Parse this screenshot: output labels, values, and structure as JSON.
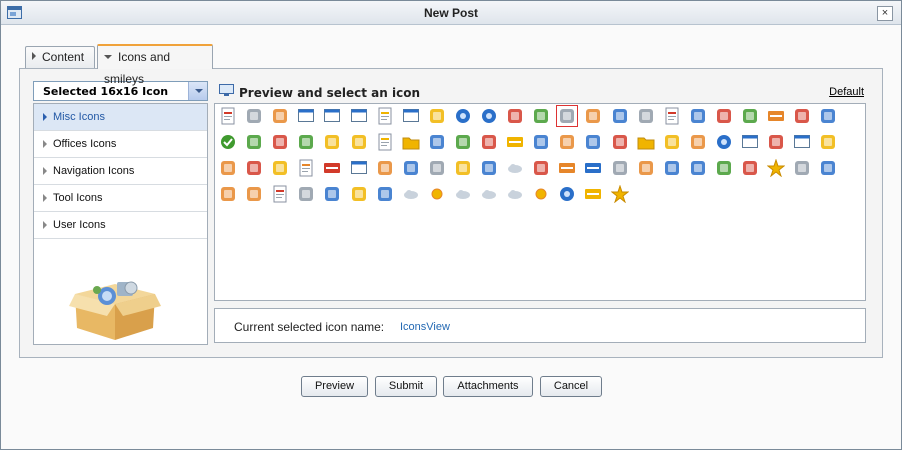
{
  "window": {
    "title": "New Post",
    "close_glyph": "×"
  },
  "tabs": [
    {
      "label": "Content",
      "active": false
    },
    {
      "label": "Icons and smileys",
      "active": true
    }
  ],
  "icon_select": {
    "value": "Selected 16x16 Icon"
  },
  "categories": [
    {
      "label": "Misc Icons",
      "active": true
    },
    {
      "label": "Offices Icons",
      "active": false
    },
    {
      "label": "Navigation Icons",
      "active": false
    },
    {
      "label": "Tool Icons",
      "active": false
    },
    {
      "label": "User Icons",
      "active": false
    }
  ],
  "preview": {
    "title": "Preview and select an icon",
    "default_link": "Default"
  },
  "current": {
    "label": "Current selected icon name:",
    "value": "IconsView"
  },
  "icons": {
    "rows": [
      [
        "pdf-icon",
        "user-icon",
        "copy-icon",
        "window-icon",
        "form-icon",
        "dialog-icon",
        "text-icon",
        "layout-icon",
        "terminal-icon",
        "globe-icon",
        "info-icon",
        "bomb-icon",
        "bookmark-icon",
        "link-icon",
        "cube-icon",
        "list-icon",
        "forward-icon",
        "edit-icon",
        "comment-icon",
        "settings-icon",
        "server-icon",
        "css-icon",
        "print-icon",
        "download-icon"
      ],
      [
        "check-icon",
        "pencil-icon",
        "puzzle-icon",
        "flag-icon",
        "clock-icon",
        "book-icon",
        "pdf-icon",
        "folder-icon",
        "font-icon",
        "hand-icon",
        "home-icon",
        "html-icon",
        "hammer-icon",
        "grid-icon",
        "move-icon",
        "cards-icon",
        "folder-icon",
        "move-icon",
        "stack-icon",
        "info-icon",
        "window-icon",
        "drive-icon",
        "window-icon",
        "link-icon"
      ],
      [
        "lock-icon",
        "record-icon",
        "magnet-icon",
        "notepad-icon",
        "new-icon",
        "frame-icon",
        "copy-icon",
        "zoom-icon",
        "printer-icon",
        "image-icon",
        "refresh-icon",
        "rainbow-icon",
        "recycle-icon",
        "rss-icon",
        "rss-icon",
        "people-icon",
        "shield-icon",
        "shapes-icon",
        "sound-icon",
        "sound-icon",
        "badge-icon",
        "star-icon",
        "chart-icon",
        "camera-icon"
      ],
      [
        "tag-icon",
        "calendar-icon",
        "text-icon",
        "linux-icon",
        "branch-icon",
        "cd-icon",
        "card-icon",
        "cloud-icon",
        "sun-cloud-icon",
        "storm-icon",
        "rain-icon",
        "snow-icon",
        "sun-icon",
        "earth-icon",
        "xhtml-icon",
        "star-icon"
      ]
    ],
    "selected_index": "0-13",
    "colors": {
      "red": "#d23a2a",
      "blue": "#2a6fc9",
      "green": "#3f9a2e",
      "yellow": "#f0b400",
      "gray": "#8f9aa6",
      "orange": "#e6862a"
    }
  },
  "buttons": {
    "preview": "Preview",
    "submit": "Submit",
    "attachments": "Attachments",
    "cancel": "Cancel"
  }
}
